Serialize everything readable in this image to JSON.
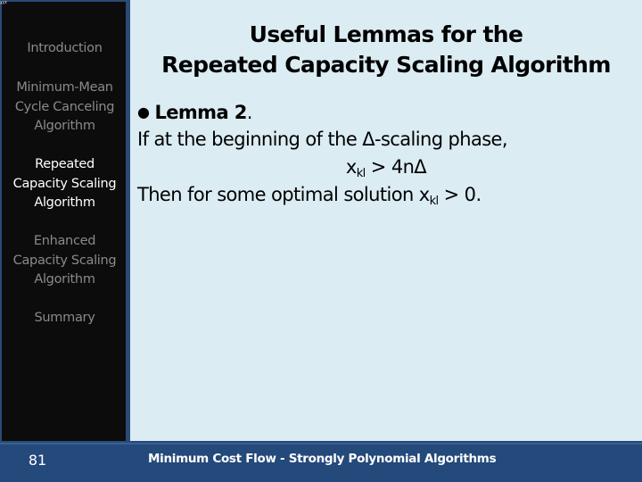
{
  "corner_mark": "ᵡᵡ²",
  "sidebar": {
    "items": [
      {
        "label": "Introduction",
        "active": false
      },
      {
        "label": "Minimum-Mean Cycle Canceling Algorithm",
        "lines": [
          "Minimum-Mean",
          "Cycle Canceling",
          "Algorithm"
        ],
        "active": false
      },
      {
        "label": "Repeated Capacity Scaling Algorithm",
        "lines": [
          "Repeated",
          "Capacity Scaling",
          "Algorithm"
        ],
        "active": true
      },
      {
        "label": "Enhanced Capacity Scaling Algorithm",
        "lines": [
          "Enhanced",
          "Capacity Scaling",
          "Algorithm"
        ],
        "active": false
      },
      {
        "label": "Summary",
        "active": false
      }
    ]
  },
  "slide": {
    "title_line1": "Useful Lemmas for the",
    "title_line2": "Repeated Capacity Scaling Algorithm",
    "bullet": "●",
    "lemma_label": "Lemma 2",
    "lemma_period": ".",
    "line2": "If at the beginning of the Δ-scaling phase,",
    "line3_var": "x",
    "line3_sub": "kl",
    "line3_rest": " > 4nΔ",
    "line4_pre": "Then for some optimal solution x",
    "line4_sub": "kl",
    "line4_rest": " > 0."
  },
  "footer": {
    "page_number": "81",
    "title": "Minimum Cost Flow - Strongly Polynomial Algorithms"
  },
  "colors": {
    "sidebar_bg": "#0c0c0c",
    "frame_blue": "#24497b",
    "content_bg": "#dbecf3",
    "nav_inactive": "#8a8a8a",
    "nav_active": "#ffffff"
  }
}
